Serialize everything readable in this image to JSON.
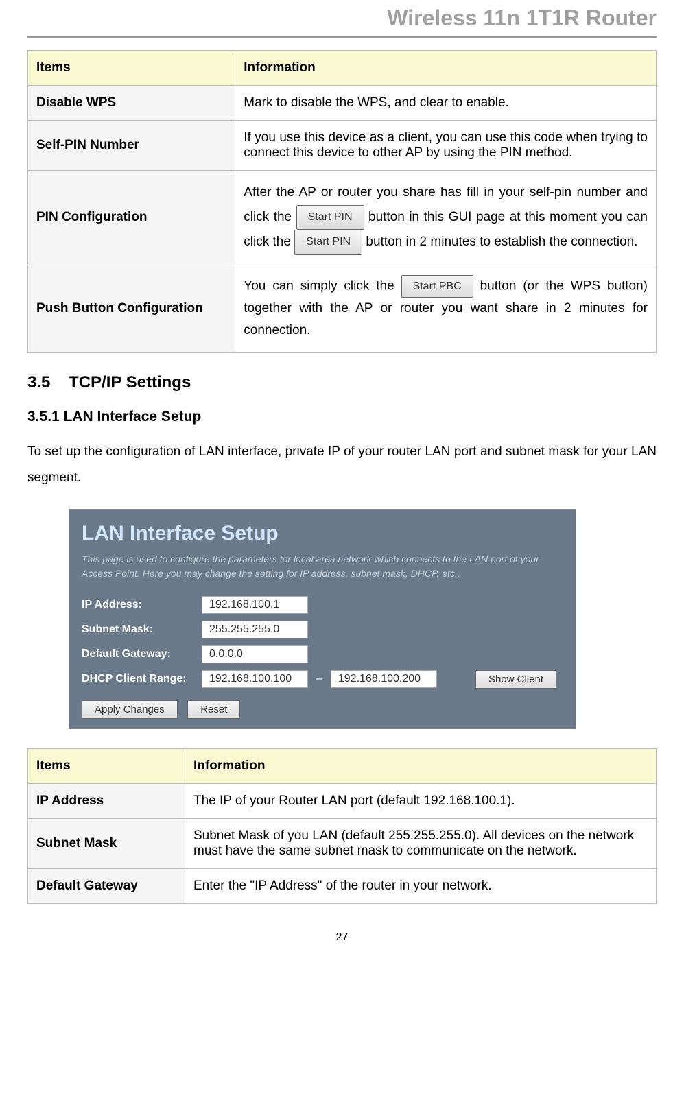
{
  "header": {
    "title": "Wireless 11n 1T1R Router"
  },
  "table1": {
    "headers": [
      "Items",
      "Information"
    ],
    "rows": [
      {
        "label": "Disable WPS",
        "info": "Mark to disable the WPS, and clear to enable."
      },
      {
        "label": "Self-PIN Number",
        "info": "If you use this device as a client, you can use this code when trying to connect this device to other AP by using the PIN method."
      },
      {
        "label": "PIN Configuration",
        "before": "After the AP or router you share has fill in your self-pin number and click the ",
        "btn1": "Start PIN",
        "mid": " button in this GUI page at this moment you can click the ",
        "btn2": "Start PIN",
        "after": " button in 2 minutes to establish the connection."
      },
      {
        "label": "Push Button Configuration",
        "before": "You can simply click the ",
        "btn1": "Start PBC",
        "after": " button (or the WPS button) together with the AP or router you want share in 2 minutes for connection."
      }
    ]
  },
  "section": {
    "num": "3.5",
    "title": "TCP/IP Settings"
  },
  "subsection": {
    "num": "3.5.1",
    "title": "LAN Interface Setup"
  },
  "paragraph": "To set up the configuration of LAN interface, private IP of your router LAN port and subnet mask for your LAN segment.",
  "screenshot": {
    "title": "LAN Interface Setup",
    "desc": "This page is used to configure the parameters for local area network which connects to the LAN port of your Access Point. Here you may change the setting for IP address, subnet mask, DHCP, etc..",
    "fields": {
      "ip_label": "IP Address:",
      "ip_val": "192.168.100.1",
      "mask_label": "Subnet Mask:",
      "mask_val": "255.255.255.0",
      "gw_label": "Default Gateway:",
      "gw_val": "0.0.0.0",
      "dhcp_label": "DHCP Client Range:",
      "dhcp_from": "192.168.100.100",
      "dhcp_sep": "–",
      "dhcp_to": "192.168.100.200",
      "show_btn": "Show Client"
    },
    "buttons": {
      "apply": "Apply Changes",
      "reset": "Reset"
    }
  },
  "table2": {
    "headers": [
      "Items",
      "Information"
    ],
    "rows": [
      {
        "label": "IP Address",
        "info": "The IP of your Router LAN port (default 192.168.100.1)."
      },
      {
        "label": "Subnet Mask",
        "info": "Subnet Mask of you LAN (default 255.255.255.0). All devices on the network must have the same subnet mask to communicate on the network."
      },
      {
        "label": "Default Gateway",
        "info": "Enter the \"IP Address\" of the router in your network."
      }
    ]
  },
  "page_number": "27"
}
